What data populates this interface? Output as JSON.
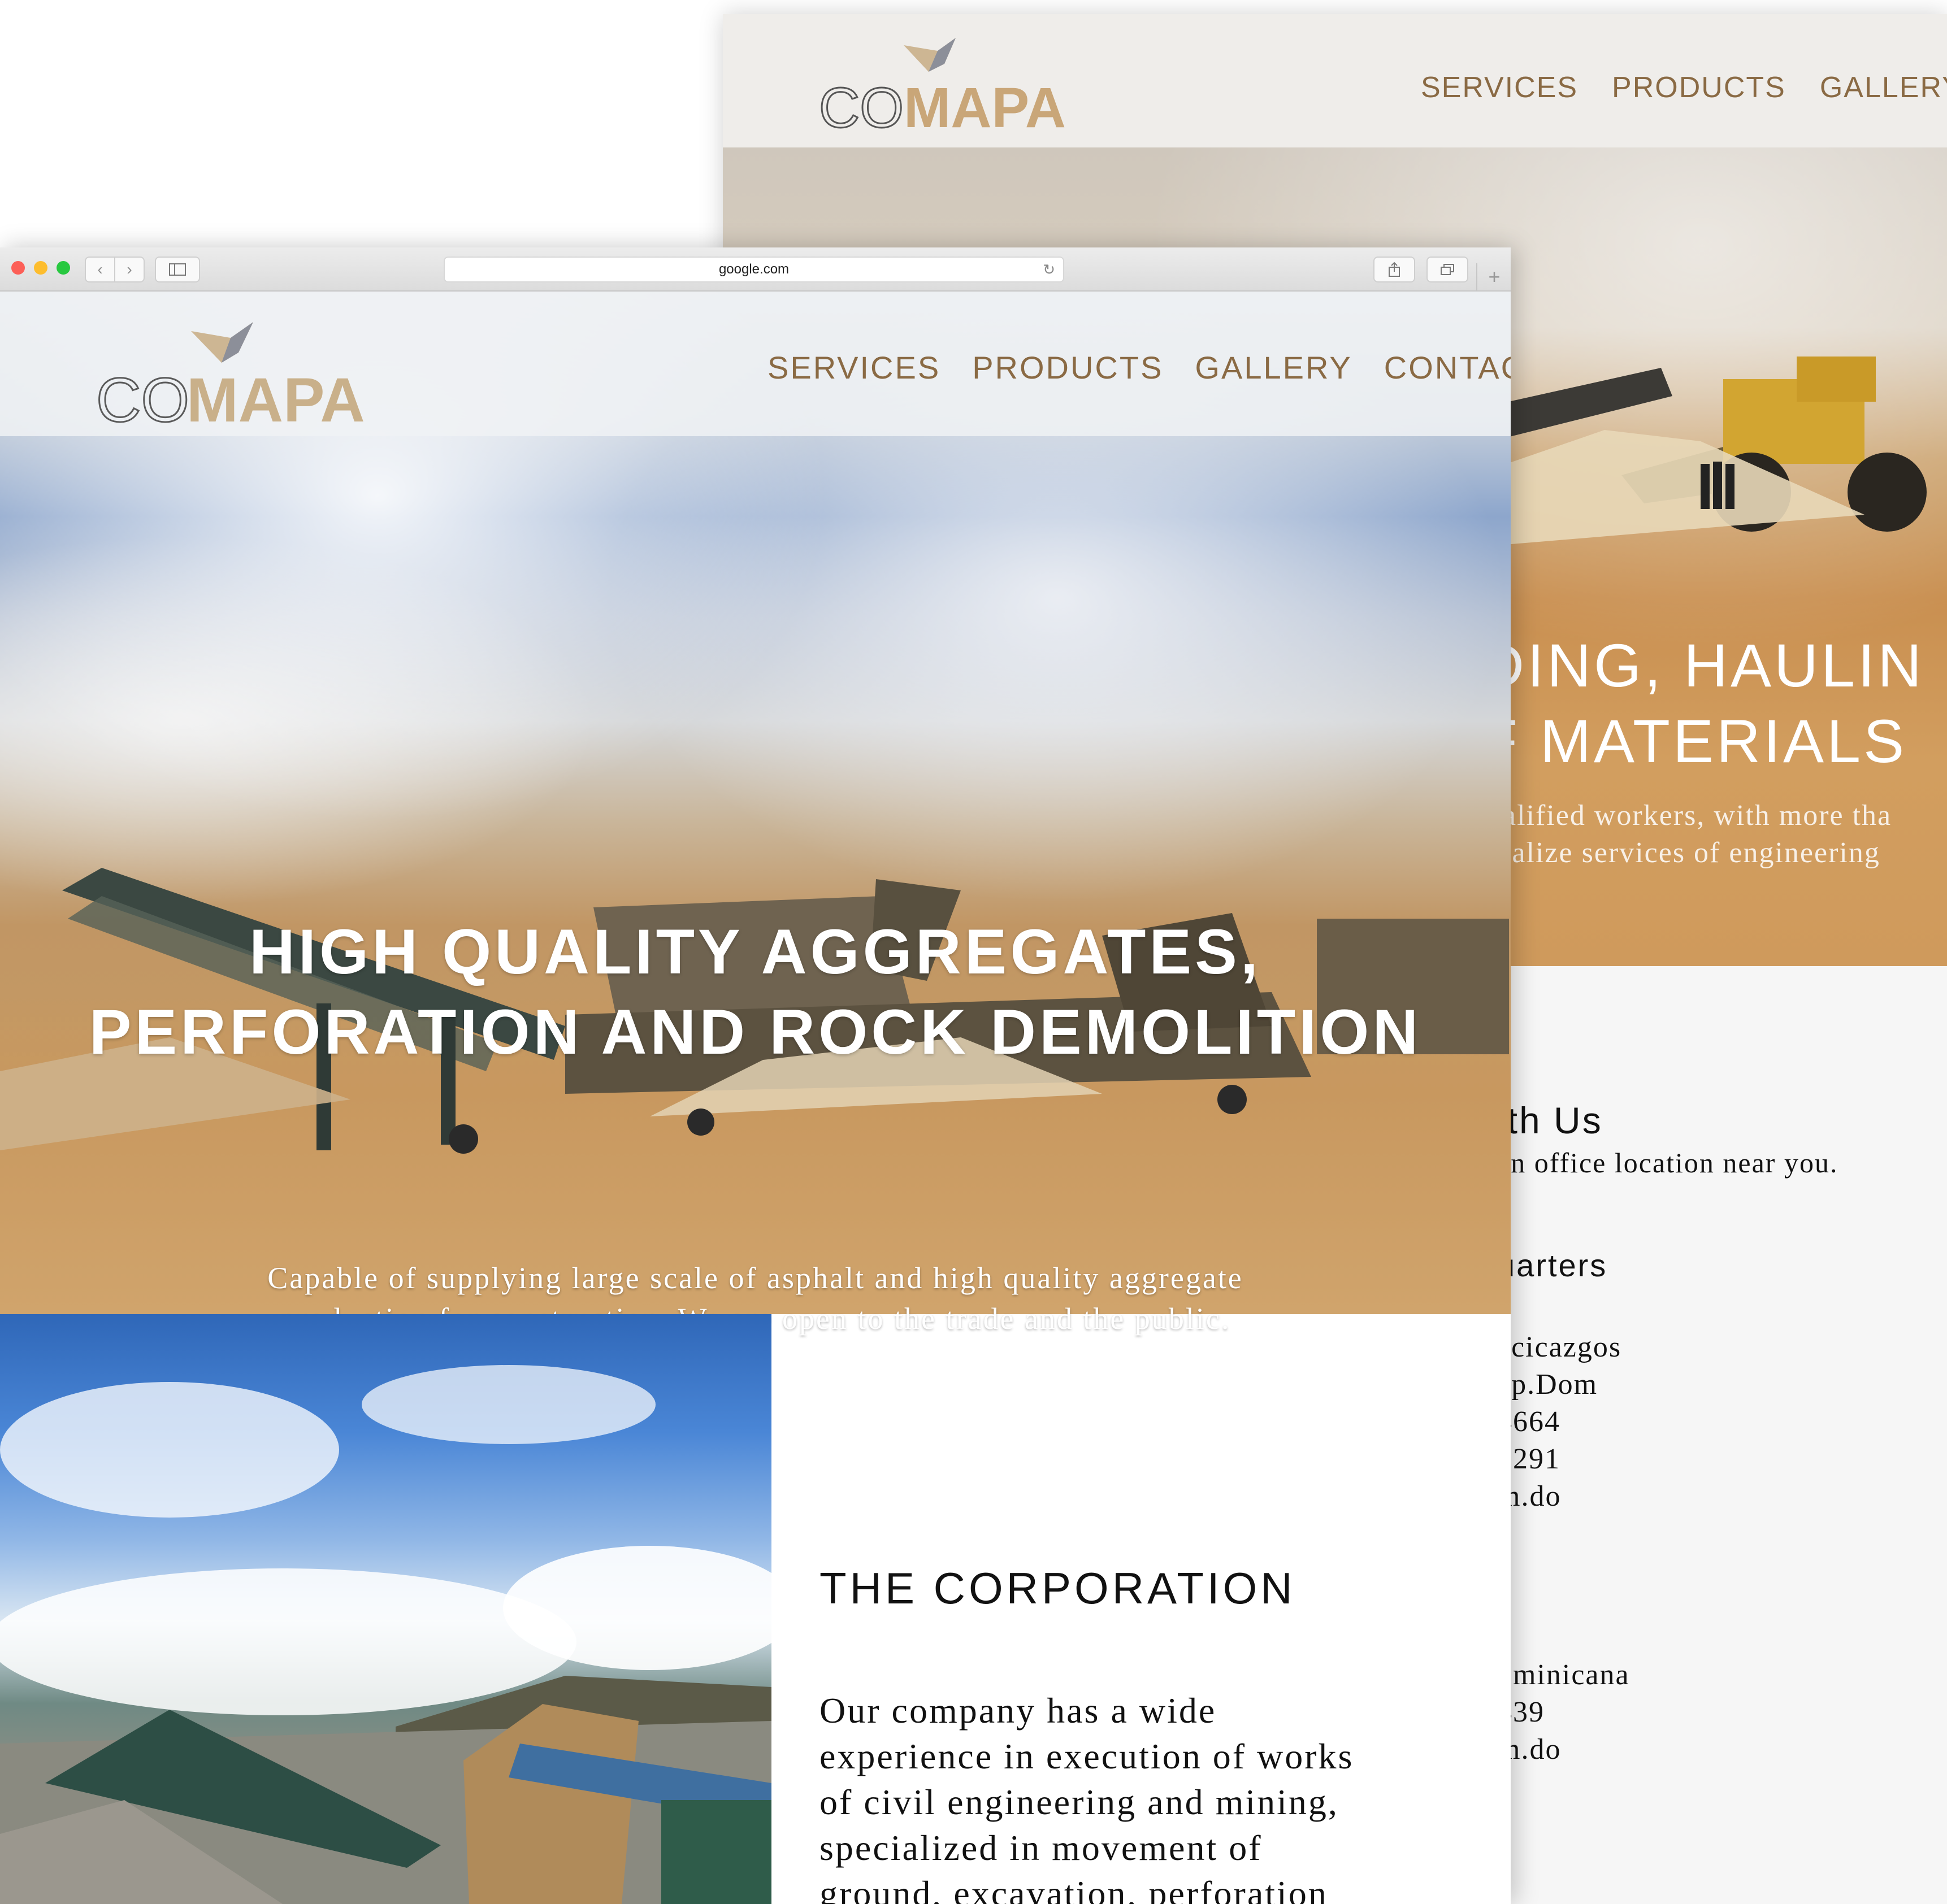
{
  "back_window": {
    "brand": {
      "co": "CO",
      "mapa": "MAPA"
    },
    "nav": {
      "services": "SERVICES",
      "products": "PRODUCTS",
      "gallery": "GALLERY"
    },
    "hero": {
      "headline_1": "DING, HAULIN",
      "headline_2": "F MATERIALS",
      "sub_1": "alified workers, with more tha",
      "sub_2": "ialize services of engineering"
    },
    "contact": {
      "title": "ith Us",
      "subtitle": "an office location near you.",
      "heading": "uarters",
      "lines_1": [
        "acicazgos",
        "ep.Dom",
        "4664",
        "5291",
        "m.do"
      ],
      "lines_2": [
        "ominicana",
        "439",
        "m.do"
      ]
    }
  },
  "browser": {
    "url": "google.com",
    "icons": {
      "back": "chevron-left-icon",
      "forward": "chevron-right-icon",
      "sidebar": "sidebar-icon",
      "reload": "reload-icon",
      "share": "share-icon",
      "tabs": "tabs-icon",
      "new_tab": "plus-icon"
    }
  },
  "site": {
    "brand": {
      "co": "CO",
      "mapa": "MAPA"
    },
    "nav": {
      "services": "SERVICES",
      "products": "PRODUCTS",
      "gallery": "GALLERY",
      "contact": "CONTACT"
    },
    "hero": {
      "headline_1": "HIGH QUALITY AGGREGATES,",
      "headline_2": "PERFORATION AND ROCK DEMOLITION",
      "sub_1": "Capable of supplying large scale of asphalt and high quality aggregate",
      "sub_2": "production for construction. We are open to the trade and the public.",
      "slide_count": 3
    },
    "corporation": {
      "title": "THE CORPORATION",
      "body_1": "Our company has a wide",
      "body_2": "experience in execution of works",
      "body_3": "of civil engineering and mining,",
      "body_4": "specialized in movement of",
      "body_5": "ground, excavation, perforation"
    },
    "colors": {
      "nav": "#8a6a44",
      "brand_tan": "#c9b08a",
      "brand_grey": "#5a5a5a"
    }
  }
}
